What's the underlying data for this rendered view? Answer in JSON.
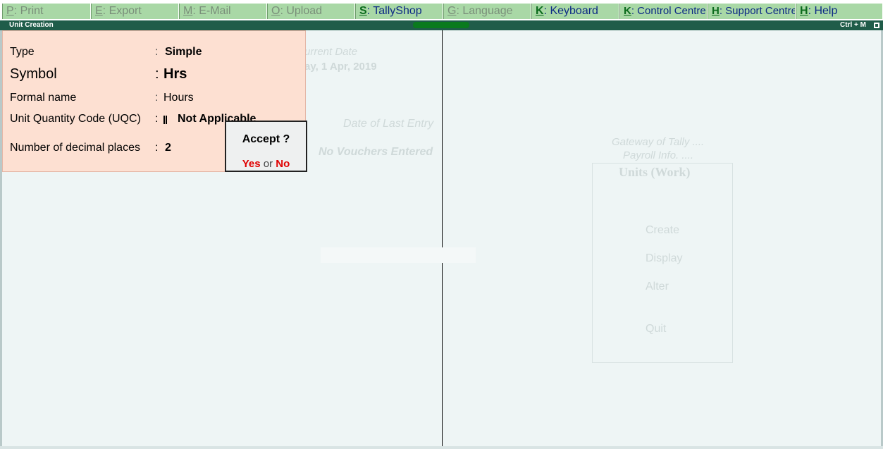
{
  "menubar": {
    "items": [
      {
        "key": "P",
        "label": ": Print",
        "enabled": false
      },
      {
        "key": "E",
        "label": ": Export",
        "enabled": false
      },
      {
        "key": "M",
        "label": ": E-Mail",
        "enabled": false
      },
      {
        "key": "O",
        "label": ": Upload",
        "enabled": false
      },
      {
        "key": "S",
        "label": ": TallyShop",
        "enabled": true
      },
      {
        "key": "G",
        "label": ": Language",
        "enabled": false
      },
      {
        "key": "K",
        "label": ": Keyboard",
        "enabled": true
      },
      {
        "key": "K",
        "label": ": Control Centre",
        "enabled": true
      },
      {
        "key": "H",
        "label": ": Support Centre",
        "enabled": true
      },
      {
        "key": "H",
        "label": ": Help",
        "enabled": true
      }
    ]
  },
  "titlebar": {
    "title": "Unit Creation",
    "shortcut": "Ctrl + M"
  },
  "form": {
    "type_label": "Type",
    "type_value": "Simple",
    "symbol_label": "Symbol",
    "symbol_value": "Hrs",
    "formal_name_label": "Formal name",
    "formal_name_value": "Hours",
    "uqc_label": "Unit Quantity Code (UQC)",
    "uqc_value": "Not Applicable",
    "decimal_label": "Number of decimal places",
    "decimal_value": "2",
    "colon": ":"
  },
  "accept_dialog": {
    "question": "Accept ?",
    "yes": "Yes",
    "or": "or",
    "no": "No"
  },
  "background": {
    "current_date_label": "urrent Date",
    "current_date_value": "ay, 1 Apr, 2019",
    "last_entry_label": "Date of Last Entry",
    "last_entry_value": "No Vouchers Entered",
    "gateway_title": "Gateway of Tally ....",
    "gateway_sub": "Payroll Info. ....",
    "units_title": "Units (Work)",
    "options": [
      "Create",
      "Display",
      "Alter",
      "Quit"
    ]
  }
}
